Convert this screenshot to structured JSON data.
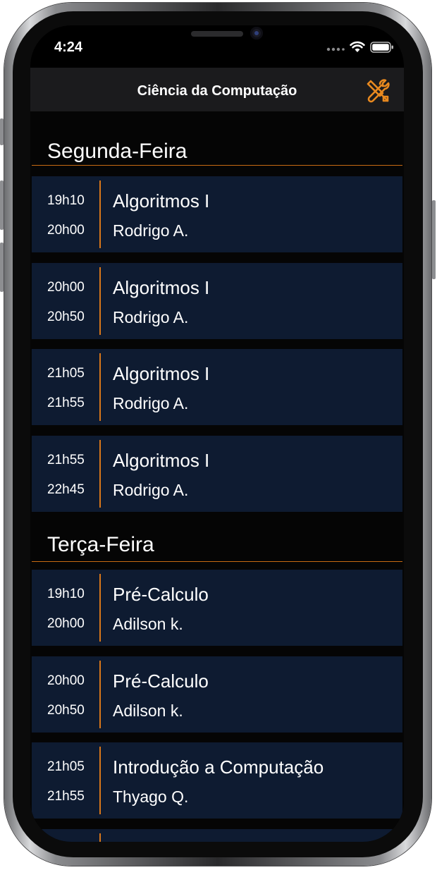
{
  "status_bar": {
    "time": "4:24"
  },
  "nav": {
    "title": "Ciência da Computação",
    "settings_icon": "tools-icon",
    "accent": "#e8891f"
  },
  "sections": [
    {
      "title": "Segunda-Feira",
      "classes": [
        {
          "start": "19h10",
          "end": "20h00",
          "subject": "Algoritmos I",
          "teacher": "Rodrigo A."
        },
        {
          "start": "20h00",
          "end": "20h50",
          "subject": "Algoritmos I",
          "teacher": "Rodrigo A."
        },
        {
          "start": "21h05",
          "end": "21h55",
          "subject": "Algoritmos I",
          "teacher": "Rodrigo A."
        },
        {
          "start": "21h55",
          "end": "22h45",
          "subject": "Algoritmos I",
          "teacher": "Rodrigo A."
        }
      ]
    },
    {
      "title": "Terça-Feira",
      "classes": [
        {
          "start": "19h10",
          "end": "20h00",
          "subject": "Pré-Calculo",
          "teacher": "Adilson k."
        },
        {
          "start": "20h00",
          "end": "20h50",
          "subject": "Pré-Calculo",
          "teacher": "Adilson k."
        },
        {
          "start": "21h05",
          "end": "21h55",
          "subject": "Introdução a Computação",
          "teacher": "Thyago Q."
        }
      ]
    }
  ],
  "colors": {
    "card_background": "#0e1b31",
    "divider": "#d9771a",
    "section_underline": "#c86a12",
    "nav_background": "#1b1b1d"
  }
}
